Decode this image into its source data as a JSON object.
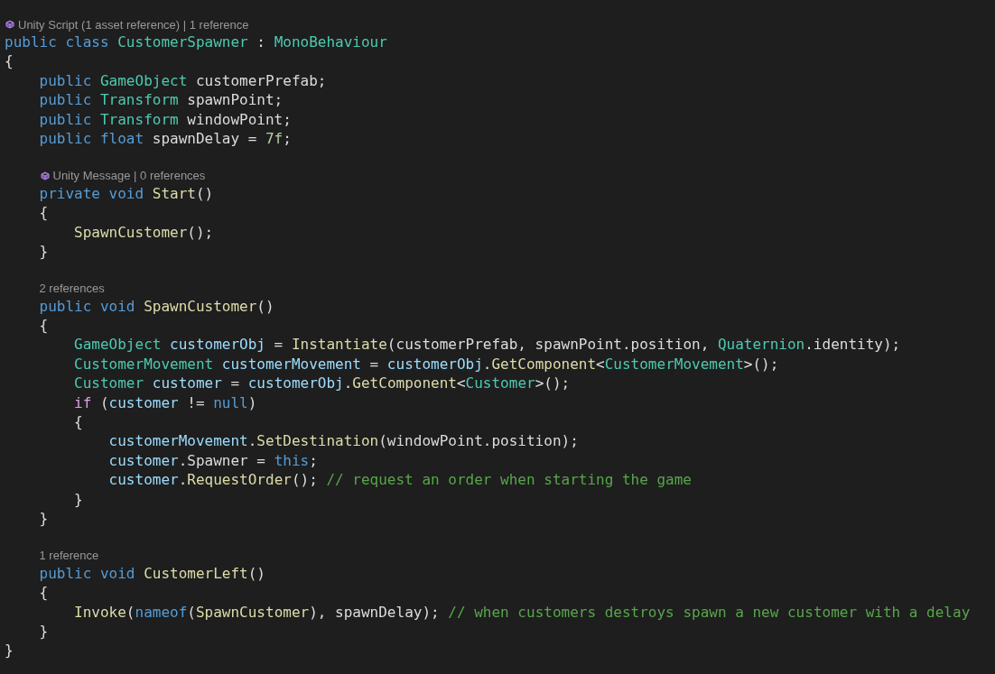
{
  "lines": [
    {
      "kind": "lens",
      "icon": true,
      "indented": false,
      "text": "Unity Script (1 asset reference) | 1 reference"
    },
    {
      "kind": "code",
      "tokens": [
        {
          "kind": "keyword",
          "text": "public"
        },
        {
          "kind": "keyword",
          "text": " class"
        },
        {
          "kind": "type",
          "text": " CustomerSpawner"
        },
        {
          "kind": "plain",
          "text": " : "
        },
        {
          "kind": "type",
          "text": "MonoBehaviour"
        }
      ]
    },
    {
      "kind": "code",
      "tokens": [
        {
          "kind": "plain",
          "text": "{"
        }
      ]
    },
    {
      "kind": "code",
      "tokens": [
        {
          "kind": "keyword",
          "text": "    public"
        },
        {
          "kind": "type",
          "text": " GameObject"
        },
        {
          "kind": "plain",
          "text": " customerPrefab;"
        }
      ]
    },
    {
      "kind": "code",
      "tokens": [
        {
          "kind": "keyword",
          "text": "    public"
        },
        {
          "kind": "type",
          "text": " Transform"
        },
        {
          "kind": "plain",
          "text": " spawnPoint;"
        }
      ]
    },
    {
      "kind": "code",
      "tokens": [
        {
          "kind": "keyword",
          "text": "    public"
        },
        {
          "kind": "type",
          "text": " Transform"
        },
        {
          "kind": "plain",
          "text": " windowPoint;"
        }
      ]
    },
    {
      "kind": "code",
      "tokens": [
        {
          "kind": "keyword",
          "text": "    public"
        },
        {
          "kind": "keyword",
          "text": " float"
        },
        {
          "kind": "plain",
          "text": " spawnDelay = "
        },
        {
          "kind": "number",
          "text": "7f"
        },
        {
          "kind": "plain",
          "text": ";"
        }
      ]
    },
    {
      "kind": "blank"
    },
    {
      "kind": "lens",
      "icon": true,
      "indented": true,
      "text": "Unity Message | 0 references"
    },
    {
      "kind": "code",
      "tokens": [
        {
          "kind": "keyword",
          "text": "    private"
        },
        {
          "kind": "keyword",
          "text": " void"
        },
        {
          "kind": "method",
          "text": " Start"
        },
        {
          "kind": "plain",
          "text": "()"
        }
      ]
    },
    {
      "kind": "code",
      "tokens": [
        {
          "kind": "plain",
          "text": "    {"
        }
      ]
    },
    {
      "kind": "code",
      "tokens": [
        {
          "kind": "method",
          "text": "        SpawnCustomer"
        },
        {
          "kind": "plain",
          "text": "();"
        }
      ]
    },
    {
      "kind": "code",
      "tokens": [
        {
          "kind": "plain",
          "text": "    }"
        }
      ]
    },
    {
      "kind": "blank"
    },
    {
      "kind": "lens",
      "icon": false,
      "indented": true,
      "text": "2 references"
    },
    {
      "kind": "code",
      "tokens": [
        {
          "kind": "keyword",
          "text": "    public"
        },
        {
          "kind": "keyword",
          "text": " void"
        },
        {
          "kind": "method",
          "text": " SpawnCustomer"
        },
        {
          "kind": "plain",
          "text": "()"
        }
      ]
    },
    {
      "kind": "code",
      "tokens": [
        {
          "kind": "plain",
          "text": "    {"
        }
      ]
    },
    {
      "kind": "code",
      "tokens": [
        {
          "kind": "type",
          "text": "        GameObject"
        },
        {
          "kind": "variable",
          "text": " customerObj"
        },
        {
          "kind": "plain",
          "text": " = "
        },
        {
          "kind": "method",
          "text": "Instantiate"
        },
        {
          "kind": "plain",
          "text": "(customerPrefab, spawnPoint.position, "
        },
        {
          "kind": "type",
          "text": "Quaternion"
        },
        {
          "kind": "plain",
          "text": ".identity);"
        }
      ]
    },
    {
      "kind": "code",
      "tokens": [
        {
          "kind": "type",
          "text": "        CustomerMovement"
        },
        {
          "kind": "variable",
          "text": " customerMovement"
        },
        {
          "kind": "plain",
          "text": " = "
        },
        {
          "kind": "variable",
          "text": "customerObj"
        },
        {
          "kind": "plain",
          "text": "."
        },
        {
          "kind": "method",
          "text": "GetComponent"
        },
        {
          "kind": "plain",
          "text": "<"
        },
        {
          "kind": "type",
          "text": "CustomerMovement"
        },
        {
          "kind": "plain",
          "text": ">();"
        }
      ]
    },
    {
      "kind": "code",
      "tokens": [
        {
          "kind": "type",
          "text": "        Customer"
        },
        {
          "kind": "variable",
          "text": " customer"
        },
        {
          "kind": "plain",
          "text": " = "
        },
        {
          "kind": "variable",
          "text": "customerObj"
        },
        {
          "kind": "plain",
          "text": "."
        },
        {
          "kind": "method",
          "text": "GetComponent"
        },
        {
          "kind": "plain",
          "text": "<"
        },
        {
          "kind": "type",
          "text": "Customer"
        },
        {
          "kind": "plain",
          "text": ">();"
        }
      ]
    },
    {
      "kind": "code",
      "tokens": [
        {
          "kind": "control",
          "text": "        if"
        },
        {
          "kind": "plain",
          "text": " ("
        },
        {
          "kind": "variable",
          "text": "customer"
        },
        {
          "kind": "plain",
          "text": " != "
        },
        {
          "kind": "keyword",
          "text": "null"
        },
        {
          "kind": "plain",
          "text": ")"
        }
      ]
    },
    {
      "kind": "code",
      "tokens": [
        {
          "kind": "plain",
          "text": "        {"
        }
      ]
    },
    {
      "kind": "code",
      "tokens": [
        {
          "kind": "variable",
          "text": "            customerMovement"
        },
        {
          "kind": "plain",
          "text": "."
        },
        {
          "kind": "method",
          "text": "SetDestination"
        },
        {
          "kind": "plain",
          "text": "(windowPoint.position);"
        }
      ]
    },
    {
      "kind": "code",
      "tokens": [
        {
          "kind": "variable",
          "text": "            customer"
        },
        {
          "kind": "plain",
          "text": ".Spawner = "
        },
        {
          "kind": "keyword",
          "text": "this"
        },
        {
          "kind": "plain",
          "text": ";"
        }
      ]
    },
    {
      "kind": "code",
      "tokens": [
        {
          "kind": "variable",
          "text": "            customer"
        },
        {
          "kind": "plain",
          "text": "."
        },
        {
          "kind": "method",
          "text": "RequestOrder"
        },
        {
          "kind": "plain",
          "text": "(); "
        },
        {
          "kind": "comment",
          "text": "// request an order when starting the game"
        }
      ]
    },
    {
      "kind": "code",
      "tokens": [
        {
          "kind": "plain",
          "text": "        }"
        }
      ]
    },
    {
      "kind": "code",
      "tokens": [
        {
          "kind": "plain",
          "text": "    }"
        }
      ]
    },
    {
      "kind": "blank"
    },
    {
      "kind": "lens",
      "icon": false,
      "indented": true,
      "text": "1 reference"
    },
    {
      "kind": "code",
      "tokens": [
        {
          "kind": "keyword",
          "text": "    public"
        },
        {
          "kind": "keyword",
          "text": " void"
        },
        {
          "kind": "method",
          "text": " CustomerLeft"
        },
        {
          "kind": "plain",
          "text": "()"
        }
      ]
    },
    {
      "kind": "code",
      "tokens": [
        {
          "kind": "plain",
          "text": "    {"
        }
      ]
    },
    {
      "kind": "code",
      "tokens": [
        {
          "kind": "method",
          "text": "        Invoke"
        },
        {
          "kind": "plain",
          "text": "("
        },
        {
          "kind": "keyword",
          "text": "nameof"
        },
        {
          "kind": "plain",
          "text": "("
        },
        {
          "kind": "method",
          "text": "SpawnCustomer"
        },
        {
          "kind": "plain",
          "text": "), spawnDelay); "
        },
        {
          "kind": "comment",
          "text": "// when customers destroys spawn a new customer with a delay"
        }
      ]
    },
    {
      "kind": "code",
      "tokens": [
        {
          "kind": "plain",
          "text": "    }"
        }
      ]
    },
    {
      "kind": "code",
      "tokens": [
        {
          "kind": "plain",
          "text": "}"
        }
      ]
    }
  ]
}
